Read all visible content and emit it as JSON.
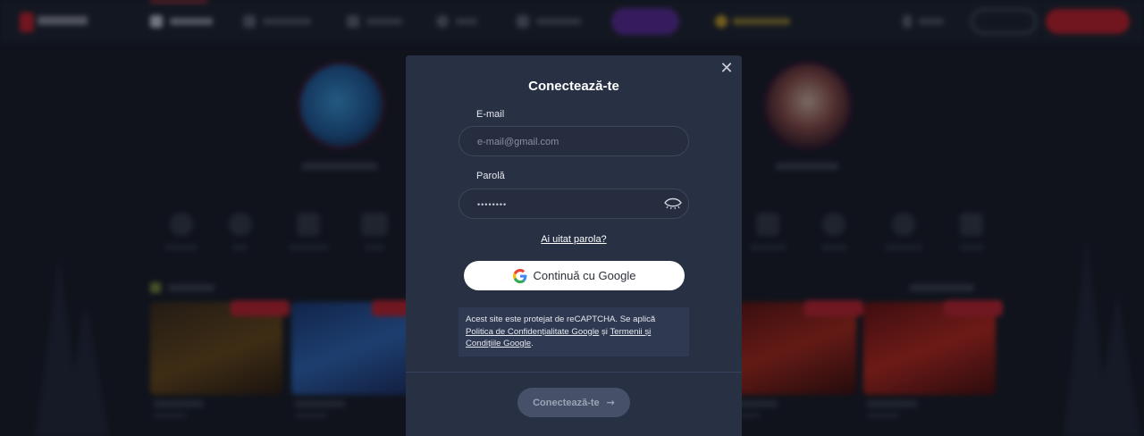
{
  "modal": {
    "title": "Conectează-te",
    "email_label": "E-mail",
    "email_placeholder": "e-mail@gmail.com",
    "password_label": "Parolă",
    "password_value": "••••••••",
    "forgot_password": "Ai uitat parola?",
    "google_button": "Continuă cu Google",
    "recaptcha": {
      "text_before": "Acest site este protejat de reCAPTCHA. Se aplică ",
      "privacy_link": "Politica de Confidențialitate Google",
      "connector": " și ",
      "terms_link": "Termenii și Condițiile Google",
      "text_after": "."
    },
    "submit_button": "Conectează-te",
    "close_icon": "close-icon",
    "show_password_icon": "eye-icon",
    "google_icon": "google-icon",
    "submit_arrow_icon": "arrow-right-icon"
  },
  "colors": {
    "modal_bg": "#283044",
    "primary_red": "#c7202d",
    "submit_disabled": "#465169"
  }
}
